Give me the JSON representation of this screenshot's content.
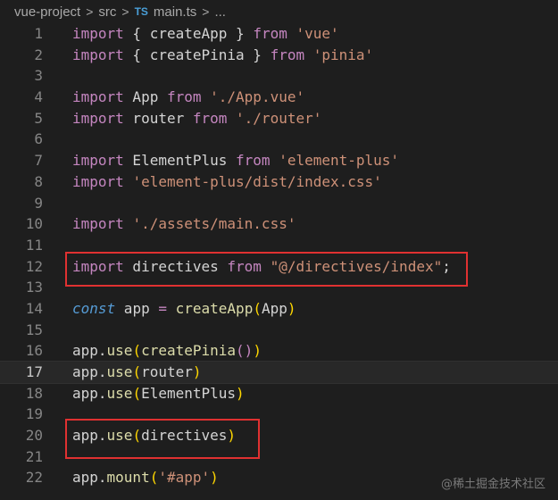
{
  "breadcrumb": {
    "items": [
      "vue-project",
      "src",
      "main.ts",
      "..."
    ],
    "file_type_badge": "TS",
    "separator": ">"
  },
  "editor": {
    "current_line": 17,
    "lines": [
      {
        "n": "1",
        "tokens": [
          [
            "kw",
            "import"
          ],
          [
            "p",
            " { "
          ],
          [
            "p",
            "createApp"
          ],
          [
            "p",
            " } "
          ],
          [
            "kw",
            "from"
          ],
          [
            "p",
            " "
          ],
          [
            "str",
            "'vue'"
          ]
        ]
      },
      {
        "n": "2",
        "tokens": [
          [
            "kw",
            "import"
          ],
          [
            "p",
            " { "
          ],
          [
            "p",
            "createPinia"
          ],
          [
            "p",
            " } "
          ],
          [
            "kw",
            "from"
          ],
          [
            "p",
            " "
          ],
          [
            "str",
            "'pinia'"
          ]
        ]
      },
      {
        "n": "3",
        "tokens": []
      },
      {
        "n": "4",
        "tokens": [
          [
            "kw",
            "import"
          ],
          [
            "p",
            " App "
          ],
          [
            "kw",
            "from"
          ],
          [
            "p",
            " "
          ],
          [
            "str",
            "'./App.vue'"
          ]
        ]
      },
      {
        "n": "5",
        "tokens": [
          [
            "kw",
            "import"
          ],
          [
            "p",
            " router "
          ],
          [
            "kw",
            "from"
          ],
          [
            "p",
            " "
          ],
          [
            "str",
            "'./router'"
          ]
        ]
      },
      {
        "n": "6",
        "tokens": []
      },
      {
        "n": "7",
        "tokens": [
          [
            "kw",
            "import"
          ],
          [
            "p",
            " ElementPlus "
          ],
          [
            "kw",
            "from"
          ],
          [
            "p",
            " "
          ],
          [
            "str",
            "'element-plus'"
          ]
        ]
      },
      {
        "n": "8",
        "tokens": [
          [
            "kw",
            "import"
          ],
          [
            "p",
            " "
          ],
          [
            "str",
            "'element-plus/dist/index.css'"
          ]
        ]
      },
      {
        "n": "9",
        "tokens": []
      },
      {
        "n": "10",
        "tokens": [
          [
            "kw",
            "import"
          ],
          [
            "p",
            " "
          ],
          [
            "str",
            "'./assets/main.css'"
          ]
        ]
      },
      {
        "n": "11",
        "tokens": []
      },
      {
        "n": "12",
        "tokens": [
          [
            "kw",
            "import"
          ],
          [
            "p",
            " directives "
          ],
          [
            "kw",
            "from"
          ],
          [
            "p",
            " "
          ],
          [
            "str",
            "\"@/directives/index\""
          ],
          [
            "p",
            ";"
          ]
        ]
      },
      {
        "n": "13",
        "tokens": []
      },
      {
        "n": "14",
        "tokens": [
          [
            "ital",
            "const"
          ],
          [
            "p",
            " app "
          ],
          [
            "kw",
            "="
          ],
          [
            "p",
            " "
          ],
          [
            "fn",
            "createApp"
          ],
          [
            "str-y",
            "("
          ],
          [
            "p",
            "App"
          ],
          [
            "str-y",
            ")"
          ]
        ]
      },
      {
        "n": "15",
        "tokens": []
      },
      {
        "n": "16",
        "tokens": [
          [
            "p",
            "app."
          ],
          [
            "fn",
            "use"
          ],
          [
            "str-y",
            "("
          ],
          [
            "fn",
            "createPinia"
          ],
          [
            "kw",
            "()"
          ],
          [
            "str-y",
            ")"
          ]
        ]
      },
      {
        "n": "17",
        "tokens": [
          [
            "p",
            "app."
          ],
          [
            "fn",
            "use"
          ],
          [
            "str-y",
            "("
          ],
          [
            "p",
            "router"
          ],
          [
            "str-y",
            ")"
          ]
        ]
      },
      {
        "n": "18",
        "tokens": [
          [
            "p",
            "app."
          ],
          [
            "fn",
            "use"
          ],
          [
            "str-y",
            "("
          ],
          [
            "p",
            "ElementPlus"
          ],
          [
            "str-y",
            ")"
          ]
        ]
      },
      {
        "n": "19",
        "tokens": []
      },
      {
        "n": "20",
        "tokens": [
          [
            "p",
            "app."
          ],
          [
            "fn",
            "use"
          ],
          [
            "str-y",
            "("
          ],
          [
            "p",
            "directives"
          ],
          [
            "str-y",
            ")"
          ]
        ]
      },
      {
        "n": "21",
        "tokens": []
      },
      {
        "n": "22",
        "tokens": [
          [
            "p",
            "app."
          ],
          [
            "fn",
            "mount"
          ],
          [
            "str-y",
            "("
          ],
          [
            "str",
            "'#app'"
          ],
          [
            "str-y",
            ")"
          ]
        ]
      }
    ]
  },
  "highlight_color": "#e03131",
  "watermark": "@稀土掘金技术社区"
}
